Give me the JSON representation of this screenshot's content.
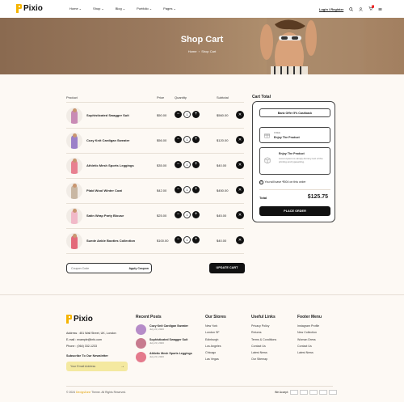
{
  "header": {
    "logo": "Pixio",
    "nav": [
      "Home",
      "Shop",
      "Blog",
      "Portfolio",
      "Pages"
    ],
    "login": "Login / Register",
    "cart_count": "0",
    "brand_color": "#f5b400"
  },
  "banner": {
    "title": "Shop Cart",
    "breadcrumb_home": "Home",
    "breadcrumb_sep": "›",
    "breadcrumb_current": "Shop Cart"
  },
  "cart": {
    "columns": [
      "Product",
      "Price",
      "Quantity",
      "Subtotal"
    ],
    "items": [
      {
        "name": "Sophisticated Swagger Suit",
        "price": "$50.00",
        "qty": "1",
        "subtotal": "$560.00",
        "color": "#c98bb5"
      },
      {
        "name": "Cozy Knit Cardigan Sweater",
        "price": "$56.00",
        "qty": "1",
        "subtotal": "$120.00",
        "color": "#9b80c8"
      },
      {
        "name": "Athletic Mesh Sports Leggings",
        "price": "$35.00",
        "qty": "1",
        "subtotal": "$40.00",
        "color": "#e88090"
      },
      {
        "name": "Plaid Wool Winter Coat",
        "price": "$42.00",
        "qty": "1",
        "subtotal": "$450.00",
        "color": "#c9b7a3"
      },
      {
        "name": "Satin Wrap Party Blouse",
        "price": "$25.00",
        "qty": "1",
        "subtotal": "$45.00",
        "color": "#f1b9c8"
      },
      {
        "name": "Suede Ankle Booties Collection",
        "price": "$100.00",
        "qty": "1",
        "subtotal": "$40.00",
        "color": "#e36a7a"
      }
    ],
    "qty_minus": "−",
    "qty_plus": "+",
    "delete_icon": "✕",
    "coupon_placeholder": "Coupon Code",
    "apply_coupon": "Apply Coupon",
    "update_cart": "UPDATE CART"
  },
  "totals": {
    "title": "Cart Total",
    "combo": "Bank Offer 5% Cashback",
    "offer1_label": "FREE",
    "offer1_title": "Enjoy The Product",
    "offer2_title": "Enjoy The Product",
    "offer2_text": "Lorem Ipsum is simply dummy text of the printing and typesetting.",
    "save_text": "You will save ₹504 on this order",
    "total_label": "Total",
    "total_value": "$125.75",
    "place_order": "PLACE ORDER"
  },
  "footer": {
    "logo": "Pixio",
    "address_label": "Address :",
    "address": "451 Wall Street, UK, London",
    "email_label": "E-mail :",
    "email": "example@info.com",
    "phone_label": "Phone :",
    "phone": "(064) 332-1233",
    "newsletter_title": "Subscribe To Our Newsletter",
    "newsletter_placeholder": "Your Email Address",
    "recent_posts_title": "Recent Posts",
    "recent_posts": [
      {
        "title": "Cozy Knit Cardigan Sweater",
        "date": "July 23, 2023"
      },
      {
        "title": "Sophisticated Swagger Suit",
        "date": "July 23, 2023"
      },
      {
        "title": "Athletic Mesh Sports Leggings",
        "date": "July 23, 2023"
      }
    ],
    "stores_title": "Our Stores",
    "stores": [
      "New York",
      "London SF",
      "Edinburgh",
      "Los Angeles",
      "Chicago",
      "Las Vegas"
    ],
    "useful_title": "Useful Links",
    "useful": [
      "Privacy Policy",
      "Returns",
      "Terms & Conditions",
      "Contact Us",
      "Latest News",
      "Our Sitemap"
    ],
    "menu_title": "Footer Menu",
    "menu": [
      "Instagram Profile",
      "New Collection",
      "Woman Dress",
      "Contact Us",
      "Latest News"
    ],
    "copyright_pre": "© 2024",
    "copyright_brand": "DexignZone",
    "copyright_post": "Theme. All Rights Reserved.",
    "we_accept": "We Accept:"
  }
}
